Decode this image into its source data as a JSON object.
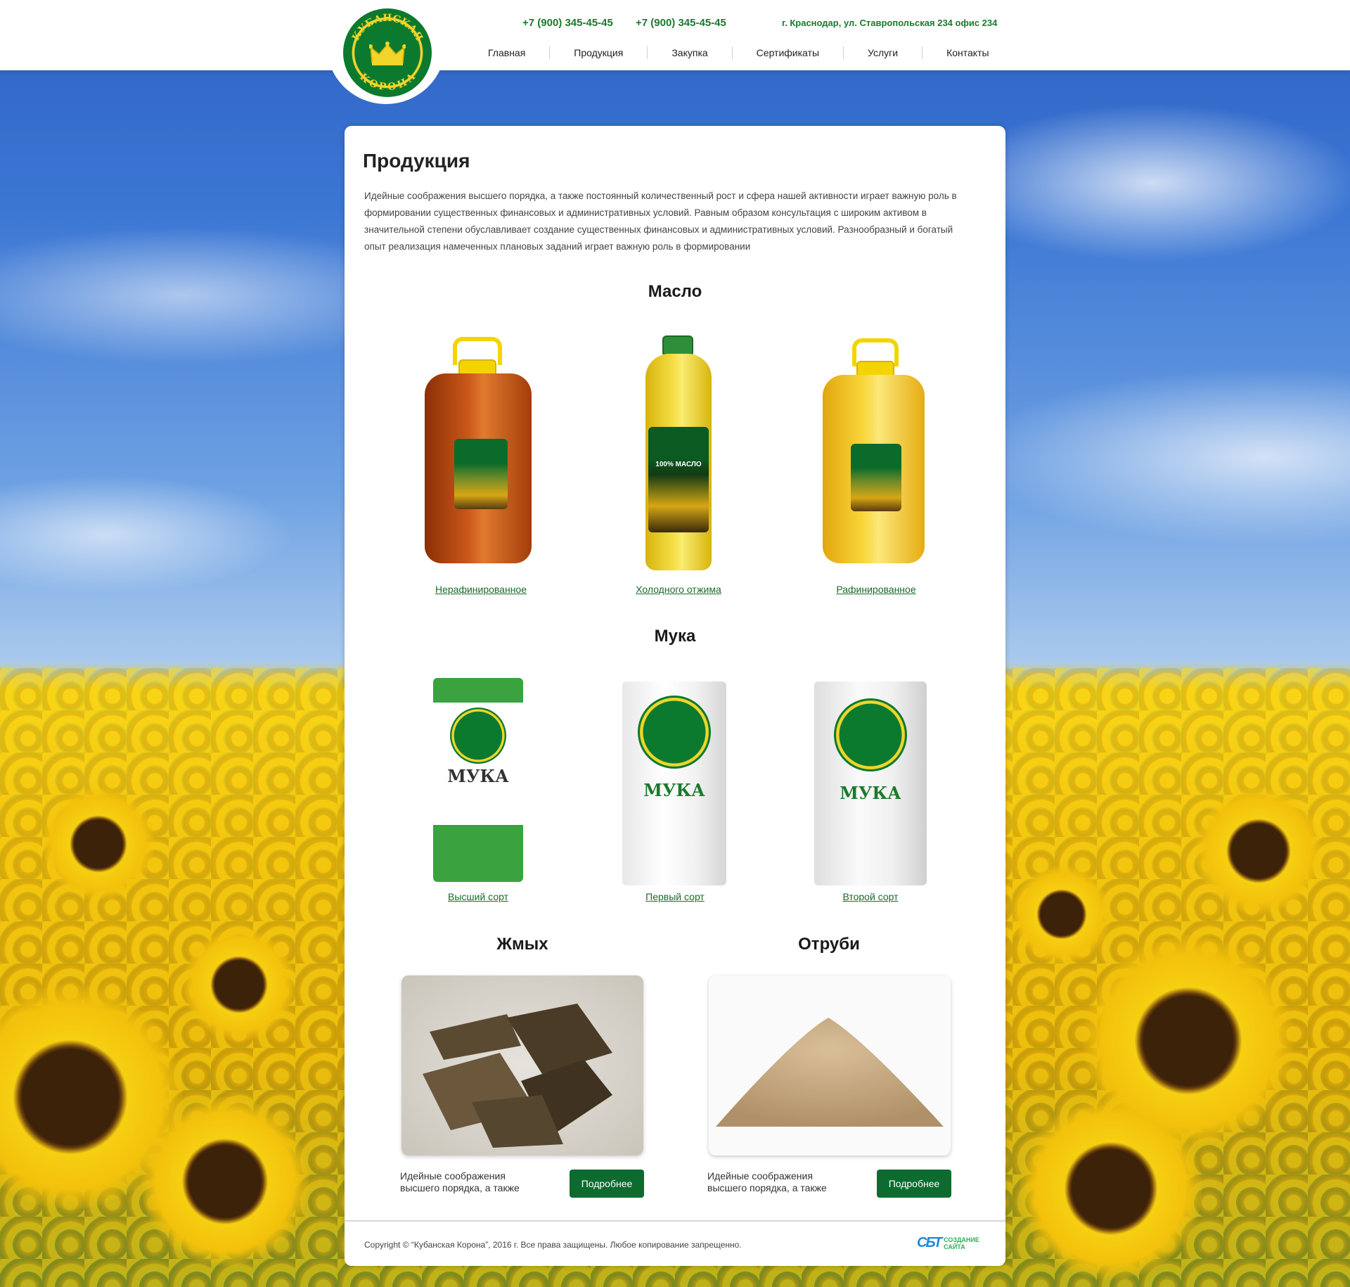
{
  "header": {
    "logo_text": "КУБАНСКАЯ КОРОНА",
    "phones": [
      "+7 (900) 345-45-45",
      "+7 (900) 345-45-45"
    ],
    "address": "г. Краснодар, ул. Ставропольская 234 офис 234",
    "nav": [
      "Главная",
      "Продукция",
      "Закупка",
      "Сертификаты",
      "Услуги",
      "Контакты"
    ]
  },
  "page": {
    "title": "Продукция",
    "intro": "Идейные соображения высшего порядка, а также постоянный количественный рост и сфера нашей активности играет важную роль в формировании существенных финансовых и административных условий. Равным образом консультация с широким активом в значительной степени обуславливает создание существенных финансовых и административных условий. Разнообразный и богатый опыт реализация намеченных плановых заданий играет важную роль в формировании"
  },
  "oil": {
    "title": "Масло",
    "items": [
      "Нерафинированное",
      "Холодного отжима",
      "Рафинированное"
    ],
    "bottle_label": "100% МАСЛО",
    "colors": [
      "#b5480e",
      "#f0d21a",
      "#f2c51f"
    ]
  },
  "flour": {
    "title": "Мука",
    "items": [
      "Высший сорт",
      "Первый сорт",
      "Второй сорт"
    ],
    "bag_label": "МУКА"
  },
  "extras": [
    {
      "title": "Жмых",
      "text": "Идейные соображения высшего порядка, а также",
      "button": "Подробнее"
    },
    {
      "title": "Отруби",
      "text": "Идейные соображения высшего порядка, а также",
      "button": "Подробнее"
    }
  ],
  "footer": {
    "copyright": "Copyright © “Кубанская Корона”, 2016 г.  Все права защищены. Любое копирование запрещенно.",
    "dev_mark": "СБТ",
    "dev_text": "СОЗДАНИЕ САЙТА"
  },
  "colors": {
    "brand_green": "#0d6b2f",
    "link_green": "#1b6a2a",
    "crown_yellow": "#f2d52a"
  }
}
